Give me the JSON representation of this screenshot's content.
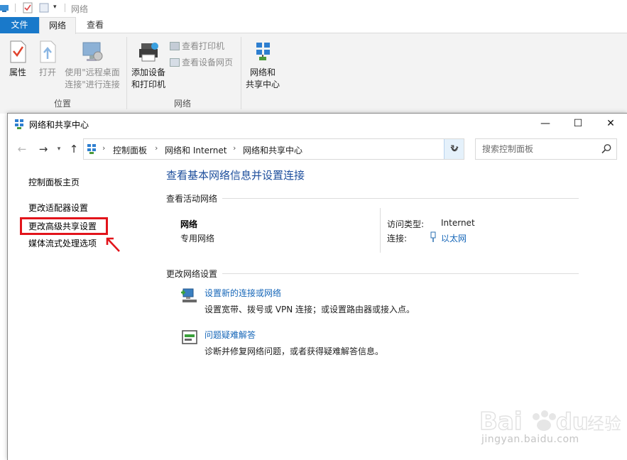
{
  "explorer": {
    "title": "网络",
    "tabs": {
      "file": "文件",
      "network": "网络",
      "view": "查看"
    },
    "ribbon": {
      "properties": "属性",
      "open": "打开",
      "remote_desktop_line1": "使用\"远程桌面",
      "remote_desktop_line2": "连接\"进行连接",
      "add_devices_line1": "添加设备",
      "add_devices_line2": "和打印机",
      "view_printers": "查看打印机",
      "view_device_webpage": "查看设备网页",
      "network_sharing_line1": "网络和",
      "network_sharing_line2": "共享中心",
      "group_location": "位置",
      "group_network": "网络"
    }
  },
  "window": {
    "title": "网络和共享中心",
    "buttons": {
      "minimize": "—",
      "maximize": "☐",
      "close": "✕"
    }
  },
  "address": {
    "breadcrumbs": [
      "控制面板",
      "网络和 Internet",
      "网络和共享中心"
    ],
    "search_placeholder": "搜索控制面板"
  },
  "sidebar": {
    "items": [
      "控制面板主页",
      "更改适配器设置",
      "更改高级共享设置",
      "媒体流式处理选项"
    ]
  },
  "main": {
    "heading": "查看基本网络信息并设置连接",
    "active_networks_label": "查看活动网络",
    "network_name": "网络",
    "network_type": "专用网络",
    "access_type_label": "访问类型:",
    "access_type_value": "Internet",
    "connections_label": "连接:",
    "connections_value": "以太网",
    "change_settings_label": "更改网络设置",
    "tasks": [
      {
        "link": "设置新的连接或网络",
        "desc": "设置宽带、拨号或 VPN 连接；或设置路由器或接入点。"
      },
      {
        "link": "问题疑难解答",
        "desc": "诊断并修复网络问题，或者获得疑难解答信息。"
      }
    ]
  },
  "watermark": {
    "brand": "Baidu经验",
    "url": "jingyan.baidu.com"
  },
  "colors": {
    "accent_blue": "#1979ca",
    "link_blue": "#1566b8",
    "heading_blue": "#1d4e9c",
    "highlight_red": "#e2141b"
  }
}
